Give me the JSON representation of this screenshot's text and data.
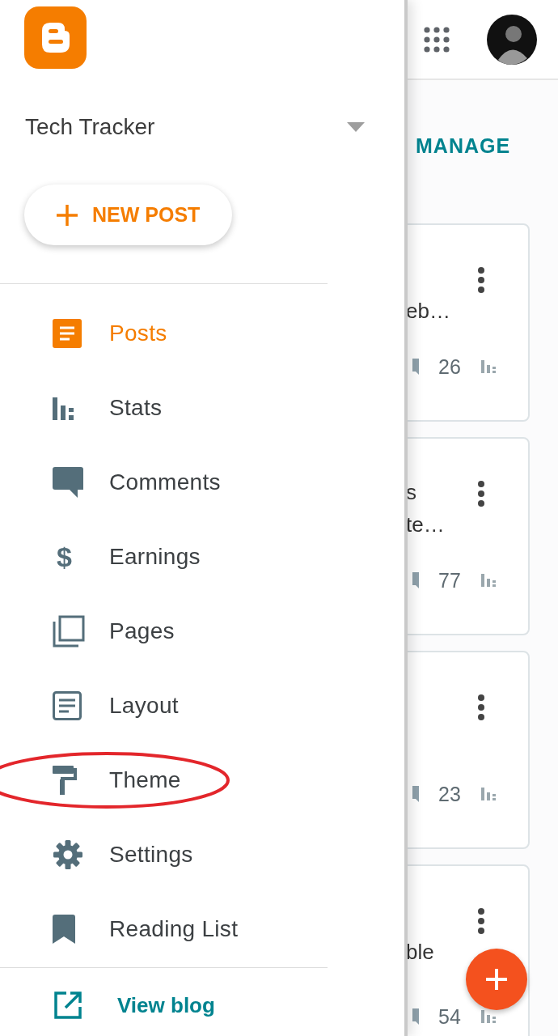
{
  "drawer": {
    "blog_title": "Tech Tracker",
    "new_post_button": "NEW POST",
    "items": [
      {
        "label": "Posts",
        "kind": "posts",
        "selected": true,
        "circled": false
      },
      {
        "label": "Stats",
        "kind": "stats",
        "selected": false,
        "circled": false
      },
      {
        "label": "Comments",
        "kind": "comments",
        "selected": false,
        "circled": false
      },
      {
        "label": "Earnings",
        "kind": "earnings",
        "glyph": "$",
        "selected": false,
        "circled": false
      },
      {
        "label": "Pages",
        "kind": "pages",
        "selected": false,
        "circled": false
      },
      {
        "label": "Layout",
        "kind": "layout",
        "selected": false,
        "circled": false
      },
      {
        "label": "Theme",
        "kind": "theme",
        "selected": false,
        "circled": true
      },
      {
        "label": "Settings",
        "kind": "settings",
        "selected": false,
        "circled": false
      },
      {
        "label": "Reading List",
        "kind": "reading",
        "selected": false,
        "circled": false
      }
    ],
    "view_blog": "View blog"
  },
  "main": {
    "manage_tab": "MANAGE",
    "posts": [
      {
        "title_lines": [
          "eb…"
        ],
        "count": "26"
      },
      {
        "title_lines": [
          "s",
          "te…"
        ],
        "count": "77"
      },
      {
        "count": "23"
      },
      {
        "title_lines": [
          "ble"
        ],
        "count": "54"
      }
    ]
  }
}
